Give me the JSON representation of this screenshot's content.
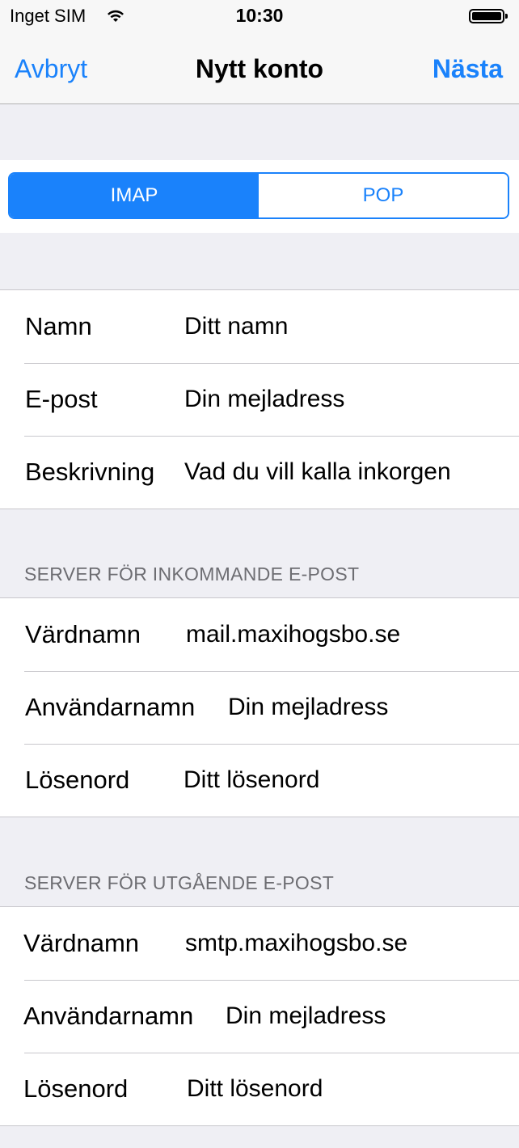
{
  "status_bar": {
    "carrier": "Inget SIM",
    "time": "10:30"
  },
  "nav": {
    "left_label": "Avbryt",
    "title": "Nytt konto",
    "right_label": "Nästa"
  },
  "segments": [
    {
      "label": "IMAP",
      "selected": true
    },
    {
      "label": "POP",
      "selected": false
    }
  ],
  "account": {
    "rows": [
      {
        "label": "Namn",
        "placeholder": "Ditt namn"
      },
      {
        "label": "E-post",
        "placeholder": "Din mejladress"
      },
      {
        "label": "Beskrivning",
        "placeholder": "Vad du vill kalla inkorgen"
      }
    ]
  },
  "incoming": {
    "header": "SERVER FÖR INKOMMANDE E-POST",
    "rows": [
      {
        "label": "Värdnamn",
        "value": "mail.maxihogsbo.se"
      },
      {
        "label": "Användarnamn",
        "value": "Din mejladress"
      },
      {
        "label": "Lösenord",
        "value": "Ditt lösenord"
      }
    ]
  },
  "outgoing": {
    "header": "SERVER FÖR UTGÅENDE E-POST",
    "rows": [
      {
        "label": "Värdnamn",
        "value": "smtp.maxihogsbo.se"
      },
      {
        "label": "Användarnamn",
        "value": "Din mejladress"
      },
      {
        "label": "Lösenord",
        "value": "Ditt lösenord"
      }
    ]
  },
  "colors": {
    "accent": "#1a82fb",
    "background": "#efeff4",
    "section_header": "#6d6d72"
  },
  "icons": [
    "wifi-icon",
    "battery-icon"
  ]
}
